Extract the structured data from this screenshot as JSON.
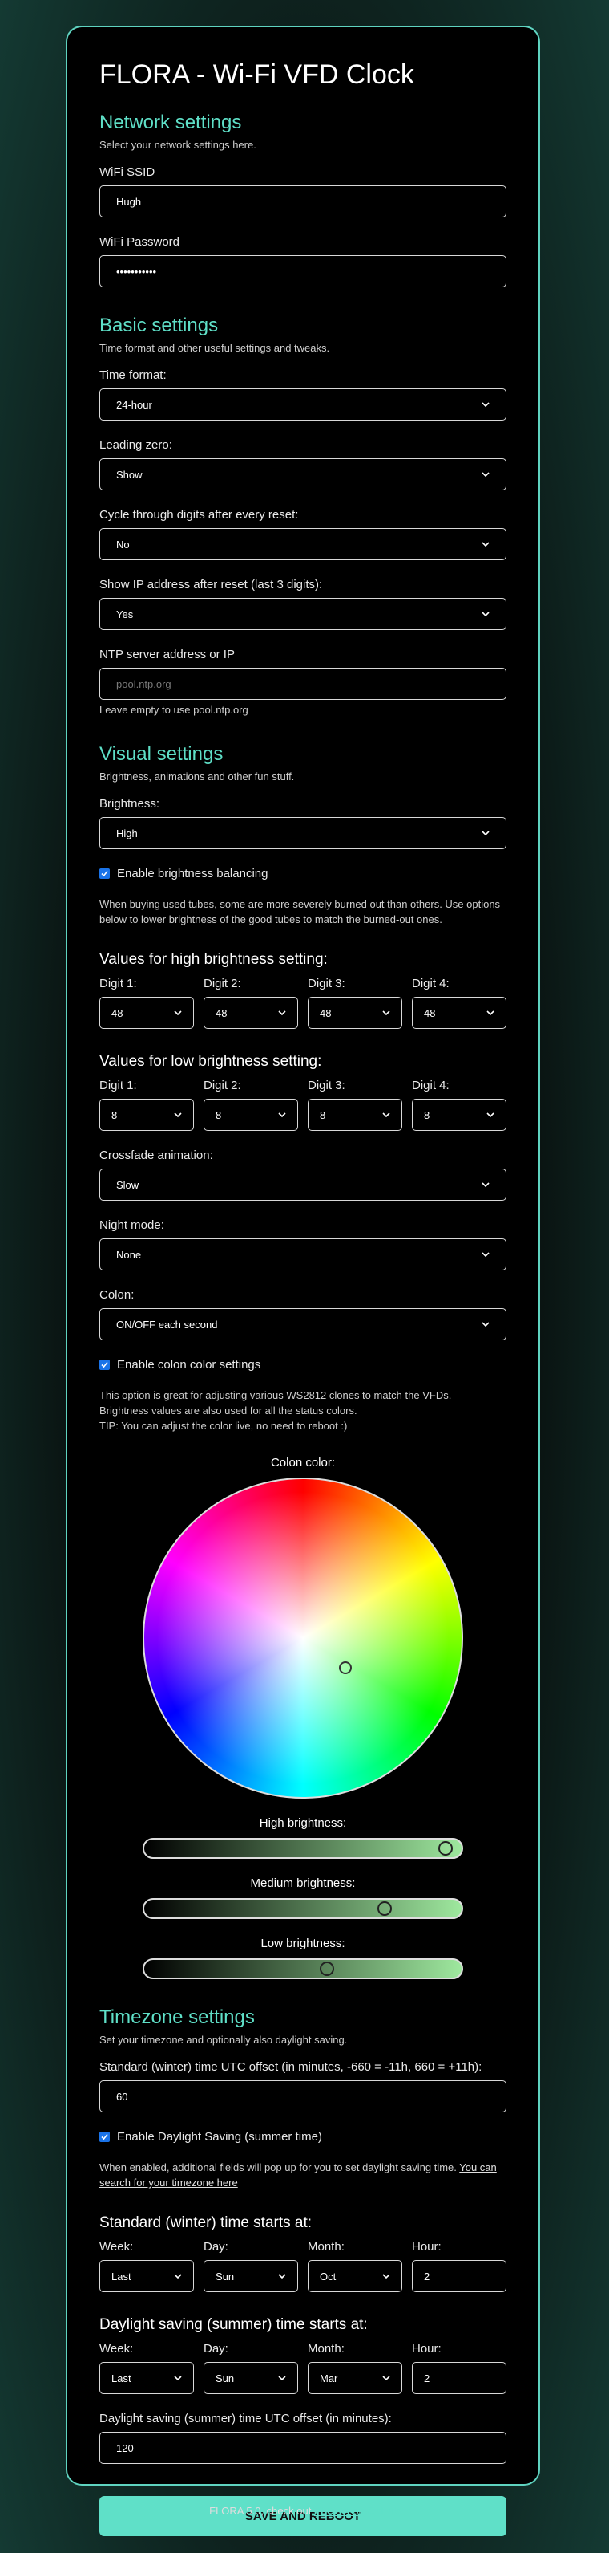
{
  "title": "FLORA - Wi-Fi VFD Clock",
  "network": {
    "heading": "Network settings",
    "desc": "Select your network settings here.",
    "ssid_label": "WiFi SSID",
    "ssid_value": "Hugh",
    "password_label": "WiFi Password",
    "password_value": "•••••••••••"
  },
  "basic": {
    "heading": "Basic settings",
    "desc": "Time format and other useful settings and tweaks.",
    "time_format_label": "Time format:",
    "time_format_value": "24-hour",
    "leading_zero_label": "Leading zero:",
    "leading_zero_value": "Show",
    "cycle_label": "Cycle through digits after every reset:",
    "cycle_value": "No",
    "show_ip_label": "Show IP address after reset (last 3 digits):",
    "show_ip_value": "Yes",
    "ntp_label": "NTP server address or IP",
    "ntp_placeholder": "pool.ntp.org",
    "ntp_hint": "Leave empty to use pool.ntp.org"
  },
  "visual": {
    "heading": "Visual settings",
    "desc": "Brightness, animations and other fun stuff.",
    "brightness_label": "Brightness:",
    "brightness_value": "High",
    "balance_check": "Enable brightness balancing",
    "balance_desc": "When buying used tubes, some are more severely burned out than others. Use options below to lower brightness of the good tubes to match the burned-out ones.",
    "high_heading": "Values for high brightness setting:",
    "low_heading": "Values for low brightness setting:",
    "digit_labels": [
      "Digit 1:",
      "Digit 2:",
      "Digit 3:",
      "Digit 4:"
    ],
    "high_values": [
      "48",
      "48",
      "48",
      "48"
    ],
    "low_values": [
      "8",
      "8",
      "8",
      "8"
    ],
    "crossfade_label": "Crossfade animation:",
    "crossfade_value": "Slow",
    "night_label": "Night mode:",
    "night_value": "None",
    "colon_label": "Colon:",
    "colon_value": "ON/OFF each second",
    "colon_check": "Enable colon color settings",
    "colon_desc_1": "This option is great for adjusting various WS2812 clones to match the VFDs.",
    "colon_desc_2": "Brightness values are also used for all the status colors.",
    "colon_desc_3": "TIP: You can adjust the color live, no need to reboot :)",
    "color_title": "Colon color:",
    "high_b_label": "High brightness:",
    "med_b_label": "Medium brightness:",
    "low_b_label": "Low brightness:",
    "high_b_level": 0.97,
    "med_b_level": 0.77,
    "low_b_level": 0.58
  },
  "timezone": {
    "heading": "Timezone settings",
    "desc": "Set your timezone and optionally also daylight saving.",
    "offset_label": "Standard (winter) time UTC offset (in minutes, -660 = -11h, 660 = +11h):",
    "offset_value": "60",
    "dst_check": "Enable Daylight Saving (summer time)",
    "dst_desc": "When enabled, additional fields will pop up for you to set daylight saving time. ",
    "dst_link": "You can search for your timezone here",
    "std_heading": "Standard (winter) time starts at:",
    "dst_heading": "Daylight saving (summer) time starts at:",
    "col_labels": [
      "Week:",
      "Day:",
      "Month:",
      "Hour:"
    ],
    "std_values": [
      "Last",
      "Sun",
      "Oct",
      "2"
    ],
    "dst_values": [
      "Last",
      "Sun",
      "Mar",
      "2"
    ],
    "dst_offset_label": "Daylight saving (summer) time UTC offset (in minutes):",
    "dst_offset_value": "120"
  },
  "save_label": "SAVE AND REBOOT",
  "footer": {
    "text": "FLORA 5.0, check out ",
    "link_strong": "FLORA",
    "link_rest": " on GitHub"
  },
  "colors": {
    "accent": "#5fe0c8",
    "border": "#5fd3c0",
    "checkbox": "#1a73e8"
  }
}
